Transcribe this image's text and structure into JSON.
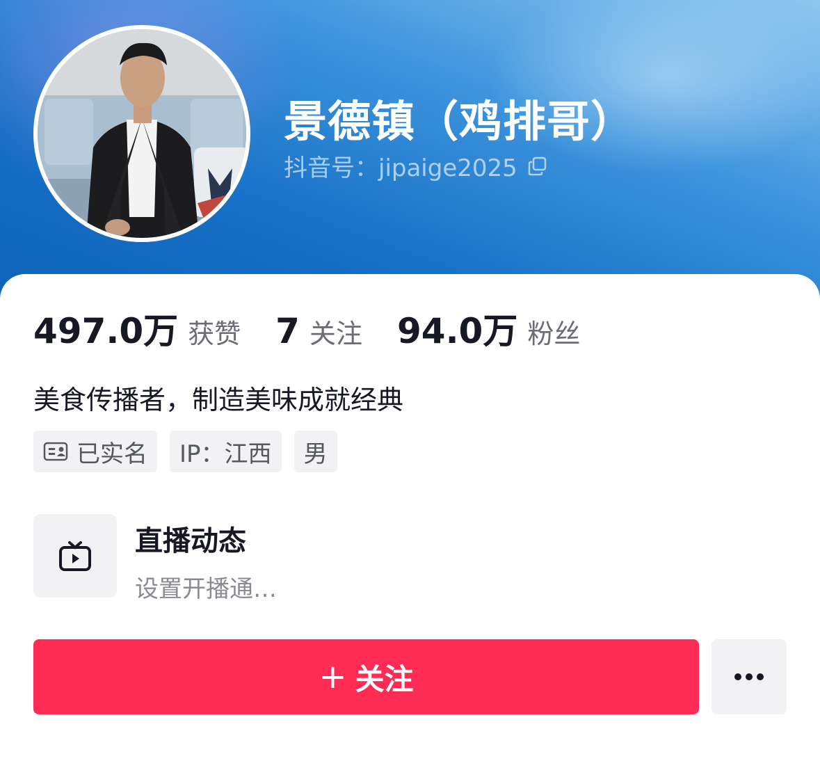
{
  "profile": {
    "name": "景德镇（鸡排哥）",
    "douyin_id": "抖音号：jipaige2025"
  },
  "stats": [
    {
      "value": "497.0万",
      "label": "获赞"
    },
    {
      "value": "7",
      "label": "关注"
    },
    {
      "value": "94.0万",
      "label": "粉丝"
    }
  ],
  "bio": "美食传播者，制造美味成就经典",
  "tags": {
    "verified": "已实名",
    "ip": "IP：江西",
    "gender": "男"
  },
  "live": {
    "title": "直播动态",
    "subtitle": "设置开播通…"
  },
  "actions": {
    "follow_plus": "+",
    "follow_label": "关注"
  },
  "colors": {
    "follow_button": "#fe2c55",
    "header_blue": "#1670c6"
  }
}
